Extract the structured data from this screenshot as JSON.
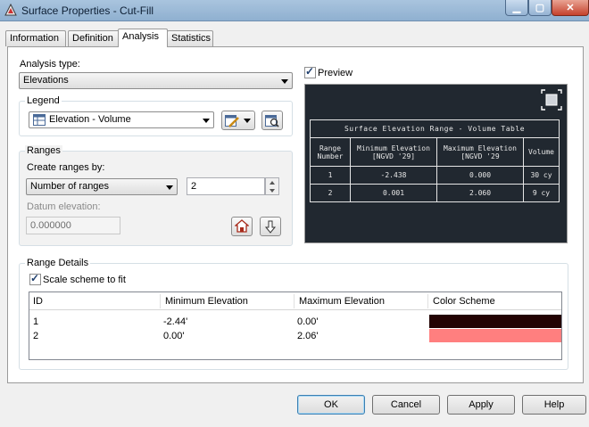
{
  "window": {
    "title": "Surface Properties - Cut-Fill"
  },
  "tabs": [
    {
      "label": "Information"
    },
    {
      "label": "Definition"
    },
    {
      "label": "Analysis"
    },
    {
      "label": "Statistics"
    }
  ],
  "analysis": {
    "type_label": "Analysis type:",
    "type_value": "Elevations",
    "legend": {
      "title": "Legend",
      "value": "Elevation - Volume"
    },
    "ranges": {
      "title": "Ranges",
      "create_by_label": "Create ranges by:",
      "create_by_value": "Number of ranges",
      "count": "2",
      "datum_label": "Datum elevation:",
      "datum_value": "0.000000"
    },
    "preview": {
      "label": "Preview",
      "checked": true,
      "table": {
        "title": "Surface Elevation Range - Volume Table",
        "headers": [
          "Range Number",
          "Minimum Elevation [NGVD '29]",
          "Maximum Elevation [NGVD '29",
          "Volume"
        ],
        "rows": [
          [
            "1",
            "-2.438",
            "0.000",
            "30 cy"
          ],
          [
            "2",
            "0.001",
            "2.060",
            "9 cy"
          ]
        ]
      }
    },
    "range_details": {
      "title": "Range Details",
      "scale_label": "Scale scheme to fit",
      "scale_checked": true,
      "columns": [
        "ID",
        "Minimum Elevation",
        "Maximum Elevation",
        "Color Scheme"
      ],
      "rows": [
        {
          "id": "1",
          "min": "-2.44'",
          "max": "0.00'",
          "color": "#230303"
        },
        {
          "id": "2",
          "min": "0.00'",
          "max": "2.06'",
          "color": "#ff7f7f"
        }
      ]
    }
  },
  "buttons": {
    "ok": "OK",
    "cancel": "Cancel",
    "apply": "Apply",
    "help": "Help"
  }
}
